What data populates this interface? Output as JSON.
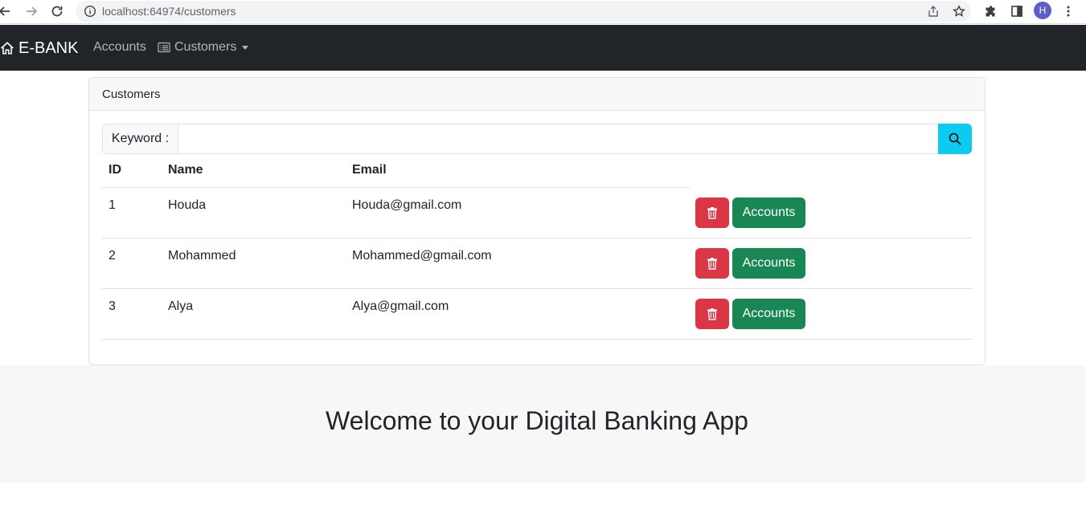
{
  "browser": {
    "url": "localhost:64974/customers",
    "profile_initial": "H"
  },
  "navbar": {
    "brand": "E-BANK",
    "accounts_link": "Accounts",
    "customers_link": "Customers"
  },
  "card": {
    "header": "Customers",
    "search": {
      "label": "Keyword :",
      "value": ""
    },
    "table": {
      "headers": [
        "ID",
        "Name",
        "Email"
      ],
      "rows": [
        {
          "id": "1",
          "name": "Houda",
          "email": "Houda@gmail.com",
          "accounts_label": "Accounts"
        },
        {
          "id": "2",
          "name": "Mohammed",
          "email": "Mohammed@gmail.com",
          "accounts_label": "Accounts"
        },
        {
          "id": "3",
          "name": "Alya",
          "email": "Alya@gmail.com",
          "accounts_label": "Accounts"
        }
      ]
    }
  },
  "footer": {
    "title": "Welcome to your Digital Banking App"
  },
  "colors": {
    "navbar_bg": "#212529",
    "search_btn": "#0dcaf0",
    "danger": "#dc3545",
    "success": "#198754"
  }
}
